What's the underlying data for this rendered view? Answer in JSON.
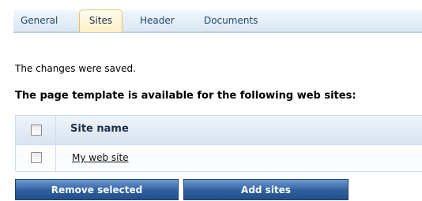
{
  "tabs": [
    {
      "label": "General",
      "active": false
    },
    {
      "label": "Sites",
      "active": true
    },
    {
      "label": "Header",
      "active": false
    },
    {
      "label": "Documents",
      "active": false
    }
  ],
  "message": "The changes were saved.",
  "section_heading": "The page template is available for the following web sites:",
  "grid": {
    "column_header": "Site name",
    "rows": [
      {
        "site_name": "My web site",
        "checked": false
      }
    ],
    "header_checkbox_checked": false
  },
  "buttons": {
    "remove_selected": "Remove selected",
    "add_sites": "Add sites"
  },
  "colors": {
    "tab_active_bg": "#fcefc2",
    "tabbar_bg": "#dbe7f4",
    "button_bg": "#2f5f9e",
    "grid_border": "#cfdceb"
  }
}
